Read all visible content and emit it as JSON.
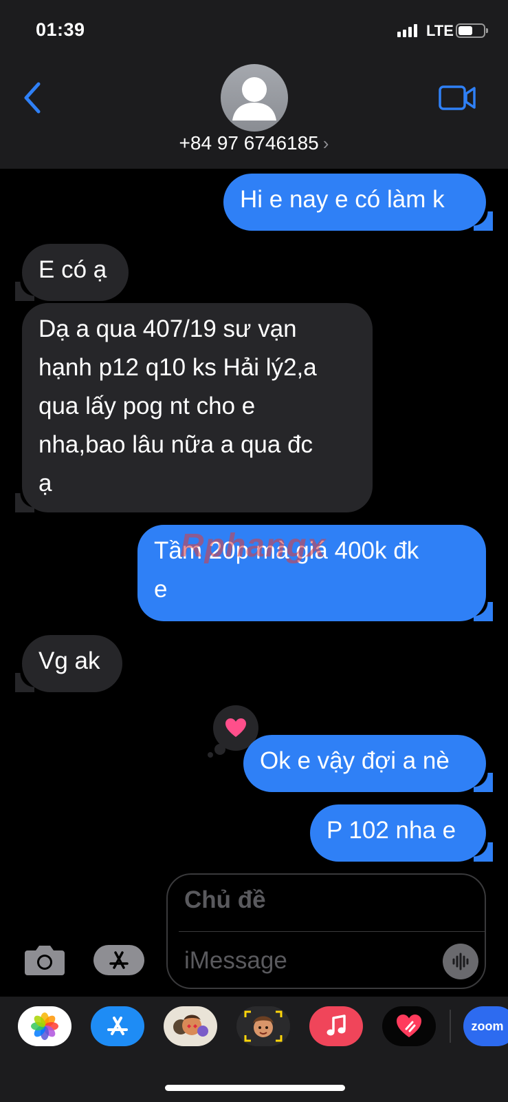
{
  "status_bar": {
    "time": "01:39",
    "network": "LTE",
    "signal_bars": 4,
    "battery_level": 0.5
  },
  "header": {
    "contact": "+84 97 6746185",
    "chevron": "›",
    "icons": [
      "back-chevron-icon",
      "contact-avatar-icon",
      "video-call-icon"
    ]
  },
  "messages": [
    {
      "direction": "sent",
      "text": "Hi e nay e có làm k"
    },
    {
      "direction": "received",
      "text": "E có ạ"
    },
    {
      "direction": "received",
      "lines": [
        "Dạ a qua 407/19 sư vạn",
        "hạnh p12 q10 ks Hải lý2,a",
        "qua lấy pog nt cho e",
        "nha,bao lâu nữa a qua đc",
        "ạ"
      ]
    },
    {
      "direction": "sent",
      "lines": [
        "Tầm 20p mà giá 400k đk",
        "e"
      ]
    },
    {
      "direction": "received",
      "text": "Vg ak"
    },
    {
      "direction": "sent",
      "text": "Ok e vậy đợi a nè",
      "reaction": "heart"
    },
    {
      "direction": "sent",
      "text": "P 102 nha e"
    }
  ],
  "watermark": "Rphangx",
  "compose": {
    "subject_placeholder": "Chủ đề",
    "message_placeholder": "iMessage"
  },
  "app_drawer": {
    "apps": [
      "photos-icon",
      "app-store-icon",
      "memoji-stickers-icon",
      "memoji-icon",
      "music-icon",
      "digital-touch-icon",
      "zoom-icon"
    ],
    "zoom_label": "zoom"
  },
  "colors": {
    "sent_bubble": "#2f80f6",
    "received_bubble": "#262629",
    "header_bg": "#1c1c1e",
    "accent": "#2f80f6",
    "reaction_heart": "#ff4f8b"
  }
}
